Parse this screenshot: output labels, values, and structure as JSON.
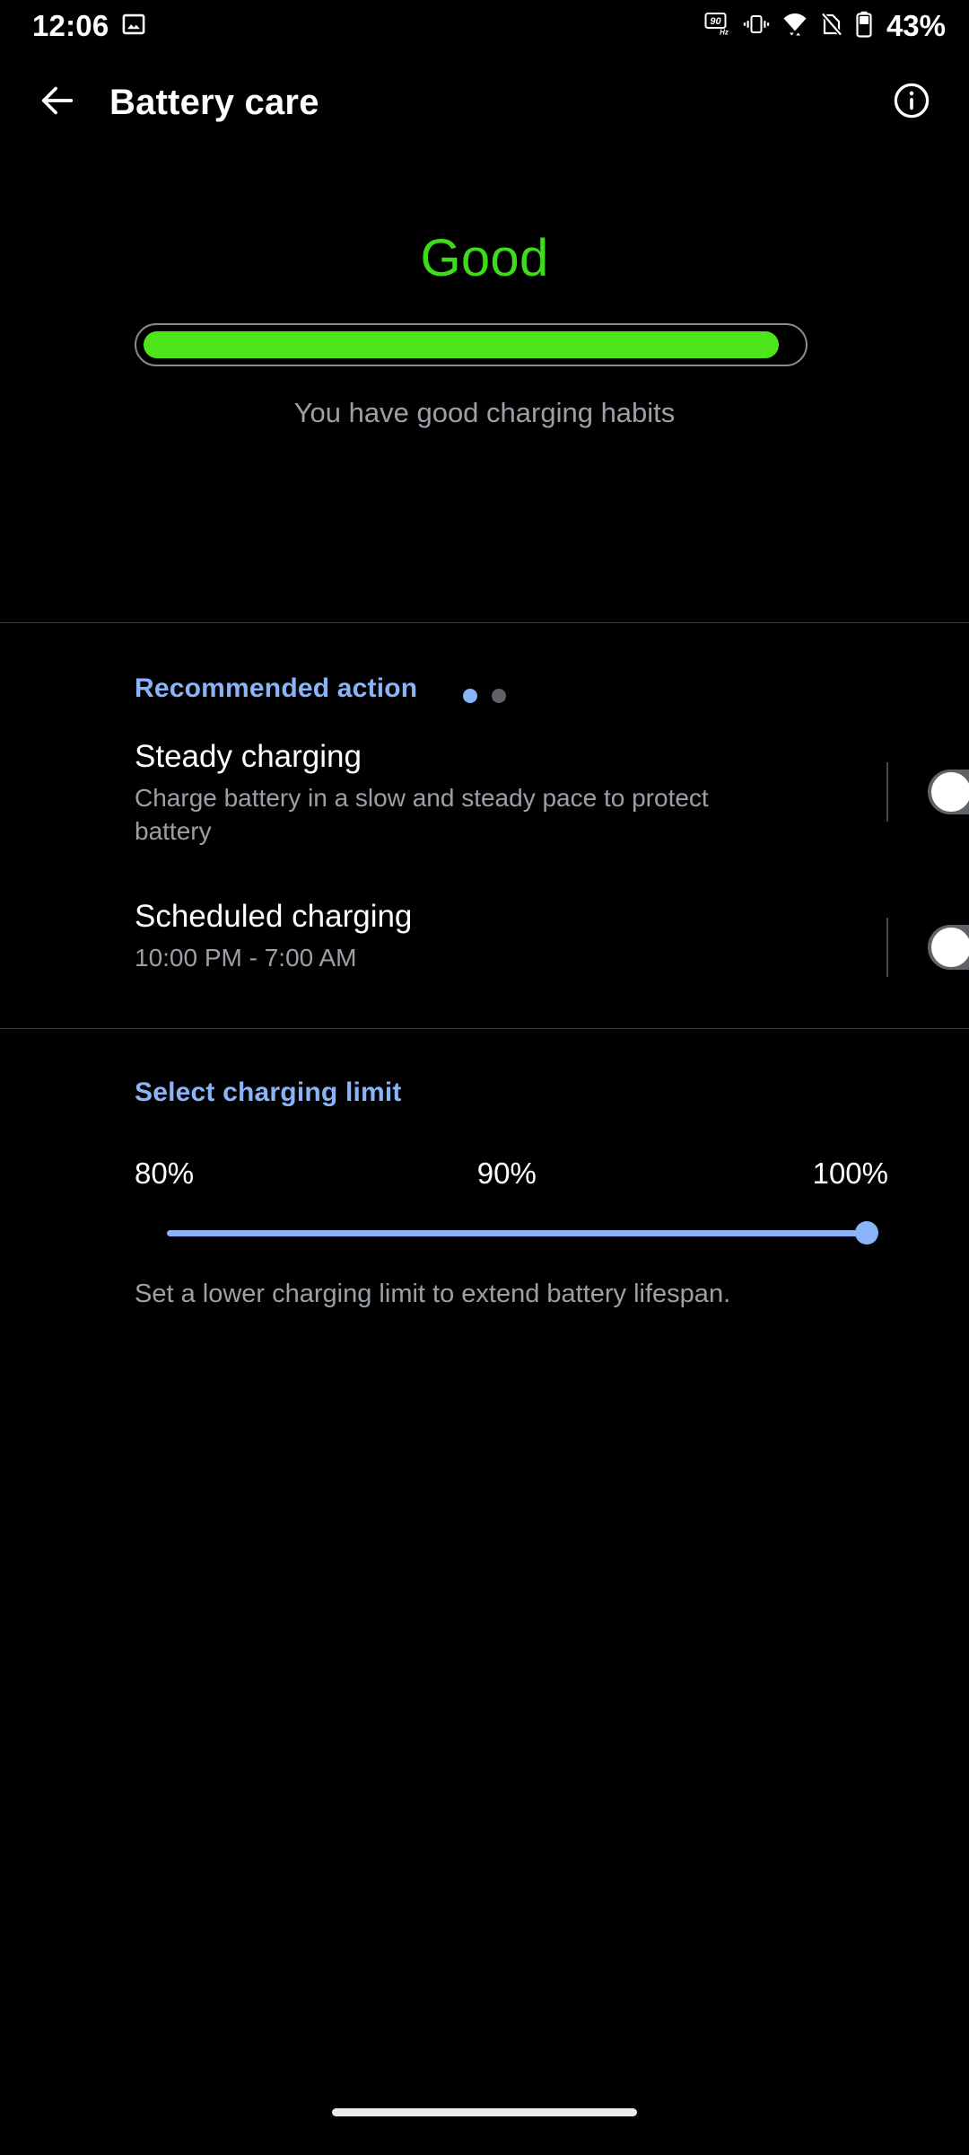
{
  "statusbar": {
    "time": "12:06",
    "notification_icon": "screenshot-image-icon",
    "icons": [
      "refresh-rate-90hz-icon",
      "vibrate-icon",
      "wifi-icon",
      "no-sim-icon",
      "battery-icon"
    ],
    "refresh_rate_value": "90",
    "refresh_rate_unit": "Hz",
    "battery_percent": "43%"
  },
  "appbar": {
    "back_icon": "back-arrow-icon",
    "title": "Battery care",
    "info_icon": "info-icon"
  },
  "hero": {
    "status_label": "Good",
    "status_color": "#3ddb1a",
    "bar_fill_percent": 97,
    "subtitle": "You have good charging habits",
    "pager": {
      "count": 2,
      "active_index": 0,
      "active_color": "#8ab4f8",
      "inactive_color": "#5f6368"
    }
  },
  "recommended": {
    "heading": "Recommended action",
    "heading_color": "#8ab4f8",
    "items": [
      {
        "title": "Steady charging",
        "subtitle": "Charge battery in a slow and steady pace to protect battery",
        "toggle_on": false
      },
      {
        "title": "Scheduled charging",
        "subtitle": "10:00 PM - 7:00 AM",
        "toggle_on": false
      }
    ]
  },
  "charging_limit": {
    "heading": "Select charging limit",
    "heading_color": "#8ab4f8",
    "ticks": [
      "80%",
      "90%",
      "100%"
    ],
    "selected_value": "100%",
    "selected_percent": 100,
    "track_color": "#8ab4f8",
    "note": "Set a lower charging limit to extend battery lifespan."
  },
  "navbar": {
    "home_indicator": "home-indicator"
  }
}
